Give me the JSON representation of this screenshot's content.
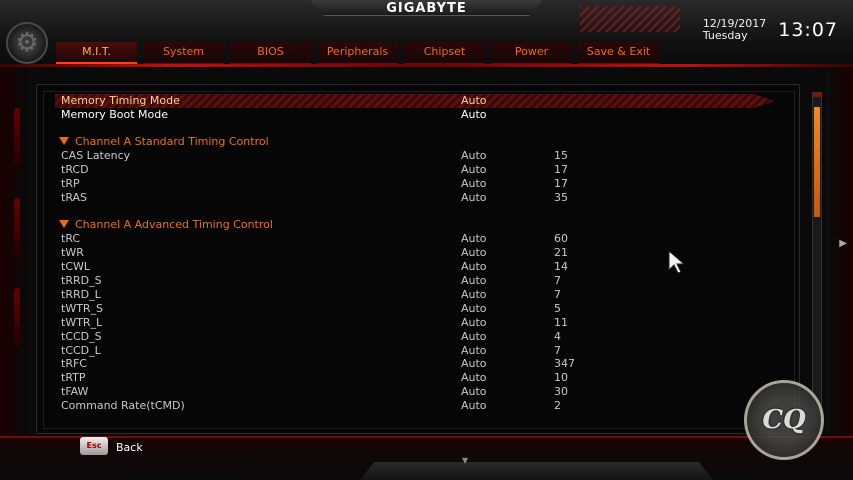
{
  "header": {
    "brand": "GIGABYTE",
    "date": "12/19/2017",
    "day": "Tuesday",
    "time": "13:07"
  },
  "tabs": [
    {
      "label": "M.I.T.",
      "active": true
    },
    {
      "label": "System",
      "active": false
    },
    {
      "label": "BIOS",
      "active": false
    },
    {
      "label": "Peripherals",
      "active": false
    },
    {
      "label": "Chipset",
      "active": false
    },
    {
      "label": "Power",
      "active": false
    },
    {
      "label": "Save & Exit",
      "active": false
    }
  ],
  "rows": [
    {
      "label": "Memory Timing Mode",
      "setting": "Auto",
      "value": "",
      "type": "selected"
    },
    {
      "label": "Memory Boot Mode",
      "setting": "Auto",
      "value": "",
      "type": "white"
    },
    {
      "label": "Channel A Standard Timing Control",
      "setting": "",
      "value": "",
      "type": "header"
    },
    {
      "label": "CAS Latency",
      "setting": "Auto",
      "value": "15",
      "type": "grey"
    },
    {
      "label": "tRCD",
      "setting": "Auto",
      "value": "17",
      "type": "grey"
    },
    {
      "label": "tRP",
      "setting": "Auto",
      "value": "17",
      "type": "grey"
    },
    {
      "label": "tRAS",
      "setting": "Auto",
      "value": "35",
      "type": "grey"
    },
    {
      "label": "Channel A Advanced Timing Control",
      "setting": "",
      "value": "",
      "type": "header"
    },
    {
      "label": "tRC",
      "setting": "Auto",
      "value": "60",
      "type": "grey"
    },
    {
      "label": "tWR",
      "setting": "Auto",
      "value": "21",
      "type": "grey"
    },
    {
      "label": "tCWL",
      "setting": "Auto",
      "value": "14",
      "type": "grey"
    },
    {
      "label": "tRRD_S",
      "setting": "Auto",
      "value": "7",
      "type": "grey"
    },
    {
      "label": "tRRD_L",
      "setting": "Auto",
      "value": "7",
      "type": "grey"
    },
    {
      "label": "tWTR_S",
      "setting": "Auto",
      "value": "5",
      "type": "grey"
    },
    {
      "label": "tWTR_L",
      "setting": "Auto",
      "value": "11",
      "type": "grey"
    },
    {
      "label": "tCCD_S",
      "setting": "Auto",
      "value": "4",
      "type": "grey"
    },
    {
      "label": "tCCD_L",
      "setting": "Auto",
      "value": "7",
      "type": "grey"
    },
    {
      "label": "tRFC",
      "setting": "Auto",
      "value": "347",
      "type": "grey"
    },
    {
      "label": "tRTP",
      "setting": "Auto",
      "value": "10",
      "type": "grey"
    },
    {
      "label": "tFAW",
      "setting": "Auto",
      "value": "30",
      "type": "grey"
    },
    {
      "label": "Command Rate(tCMD)",
      "setting": "Auto",
      "value": "2",
      "type": "grey"
    }
  ],
  "footer": {
    "esc_key": "Esc",
    "back_label": "Back"
  },
  "icons": {
    "settings": "gear-icon",
    "pointer": "mouse-pointer-icon",
    "watermark": "watermark-logo"
  },
  "colors": {
    "accent": "#ea7020",
    "selected_text": "#ffcf8a",
    "brand_red": "#c01010"
  }
}
